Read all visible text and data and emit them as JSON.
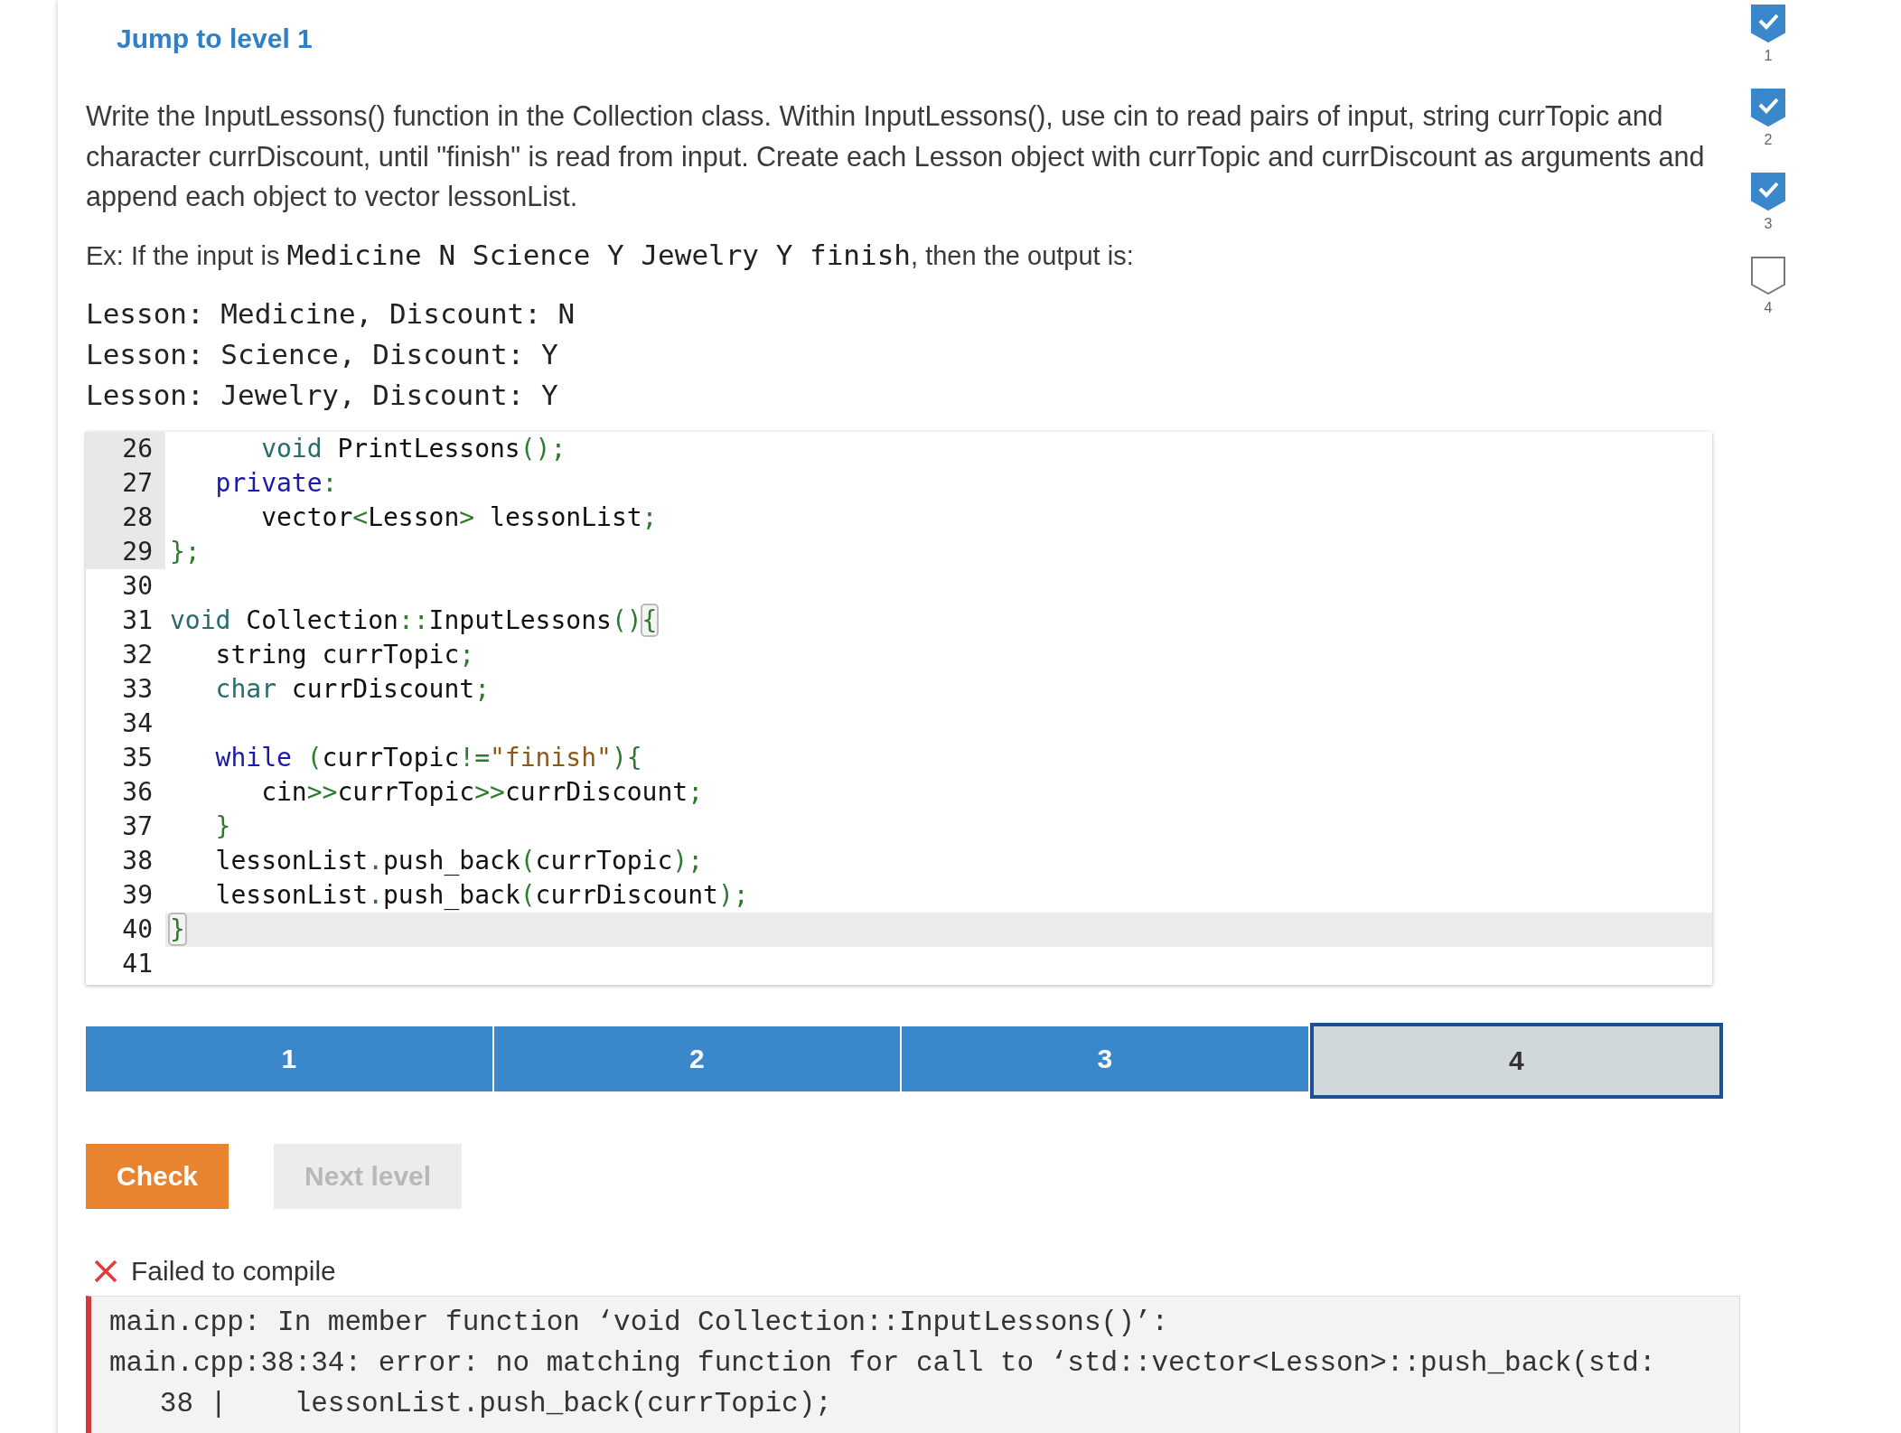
{
  "jump_link": "Jump to level 1",
  "instructions": "Write the InputLessons() function in the Collection class. Within InputLessons(), use cin to read pairs of input, string currTopic and character currDiscount, until \"finish\" is read from input. Create each Lesson object with currTopic and currDiscount as arguments and append each object to vector lessonList.",
  "example": {
    "prefix": "Ex: If the input is ",
    "input": "Medicine N Science Y Jewelry Y finish",
    "suffix": ", then the output is:"
  },
  "expected_output": [
    "Lesson: Medicine, Discount: N",
    "Lesson: Science, Discount: Y",
    "Lesson: Jewelry, Discount: Y"
  ],
  "code_editor": {
    "lines": [
      {
        "number": "26",
        "marked": true,
        "active": false,
        "tokens": [
          {
            "t": "      void",
            "kind": "type"
          },
          {
            "t": " PrintLessons",
            "kind": "plain"
          },
          {
            "t": "();",
            "kind": "punct"
          }
        ]
      },
      {
        "number": "27",
        "marked": true,
        "active": false,
        "tokens": [
          {
            "t": "   private",
            "kind": "keyword"
          },
          {
            "t": ":",
            "kind": "punct"
          }
        ]
      },
      {
        "number": "28",
        "marked": true,
        "active": false,
        "tokens": [
          {
            "t": "      vector",
            "kind": "plain"
          },
          {
            "t": "<",
            "kind": "punct"
          },
          {
            "t": "Lesson",
            "kind": "plain"
          },
          {
            "t": ">",
            "kind": "punct"
          },
          {
            "t": " lessonList",
            "kind": "plain"
          },
          {
            "t": ";",
            "kind": "punct"
          }
        ]
      },
      {
        "number": "29",
        "marked": true,
        "active": false,
        "tokens": [
          {
            "t": "};",
            "kind": "punct"
          }
        ]
      },
      {
        "number": "30",
        "marked": false,
        "active": false
      },
      {
        "number": "31",
        "marked": false,
        "active": false,
        "tokens": [
          {
            "t": "void",
            "kind": "type"
          },
          {
            "t": " Collection",
            "kind": "plain"
          },
          {
            "t": "::",
            "kind": "punct"
          },
          {
            "t": "InputLessons",
            "kind": "plain"
          },
          {
            "t": "()",
            "kind": "punct"
          },
          {
            "t": "{",
            "kind": "bracket_match"
          }
        ]
      },
      {
        "number": "32",
        "marked": false,
        "active": false,
        "tokens": [
          {
            "t": "   string currTopic",
            "kind": "plain"
          },
          {
            "t": ";",
            "kind": "punct"
          }
        ]
      },
      {
        "number": "33",
        "marked": false,
        "active": false,
        "tokens": [
          {
            "t": "   char",
            "kind": "type"
          },
          {
            "t": " currDiscount",
            "kind": "plain"
          },
          {
            "t": ";",
            "kind": "punct"
          }
        ]
      },
      {
        "number": "34",
        "marked": false,
        "active": false
      },
      {
        "number": "35",
        "marked": false,
        "active": false,
        "tokens": [
          {
            "t": "   while",
            "kind": "keyword"
          },
          {
            "t": " (",
            "kind": "punct"
          },
          {
            "t": "currTopic",
            "kind": "plain"
          },
          {
            "t": "!=",
            "kind": "punct"
          },
          {
            "t": "\"finish\"",
            "kind": "string"
          },
          {
            "t": "){",
            "kind": "punct"
          }
        ]
      },
      {
        "number": "36",
        "marked": false,
        "active": false,
        "tokens": [
          {
            "t": "      cin",
            "kind": "plain"
          },
          {
            "t": ">>",
            "kind": "punct"
          },
          {
            "t": "currTopic",
            "kind": "plain"
          },
          {
            "t": ">>",
            "kind": "punct"
          },
          {
            "t": "currDiscount",
            "kind": "plain"
          },
          {
            "t": ";",
            "kind": "punct"
          }
        ]
      },
      {
        "number": "37",
        "marked": false,
        "active": false,
        "tokens": [
          {
            "t": "   }",
            "kind": "punct"
          }
        ]
      },
      {
        "number": "38",
        "marked": false,
        "active": false,
        "tokens": [
          {
            "t": "   lessonList",
            "kind": "plain"
          },
          {
            "t": ".",
            "kind": "punct"
          },
          {
            "t": "push_back",
            "kind": "plain"
          },
          {
            "t": "(",
            "kind": "punct"
          },
          {
            "t": "currTopic",
            "kind": "plain"
          },
          {
            "t": ");",
            "kind": "punct"
          }
        ]
      },
      {
        "number": "39",
        "marked": false,
        "active": false,
        "tokens": [
          {
            "t": "   lessonList",
            "kind": "plain"
          },
          {
            "t": ".",
            "kind": "punct"
          },
          {
            "t": "push_back",
            "kind": "plain"
          },
          {
            "t": "(",
            "kind": "punct"
          },
          {
            "t": "currDiscount",
            "kind": "plain"
          },
          {
            "t": ");",
            "kind": "punct"
          }
        ]
      },
      {
        "number": "40",
        "marked": false,
        "active": true,
        "tokens": [
          {
            "t": "}",
            "kind": "bracket_match"
          }
        ]
      },
      {
        "number": "41",
        "marked": false,
        "active": false
      }
    ]
  },
  "levels": [
    {
      "label": "1",
      "completed": true,
      "selected": false
    },
    {
      "label": "2",
      "completed": true,
      "selected": false
    },
    {
      "label": "3",
      "completed": true,
      "selected": false
    },
    {
      "label": "4",
      "completed": false,
      "selected": true
    }
  ],
  "buttons": [
    {
      "label": "Check",
      "kind": "primary",
      "disabled": false
    },
    {
      "label": "Next level",
      "kind": "secondary",
      "disabled": true
    }
  ],
  "result": {
    "status": "Failed to compile",
    "errors": [
      "main.cpp: In member function ‘void Collection::InputLessons()’:",
      "main.cpp:38:34: error: no matching function for call to ‘std::vector<Lesson>::push_back(std:",
      "   38 |    lessonList.push_back(currTopic);"
    ]
  },
  "sidebar_levels": [
    {
      "label": "1",
      "done": true
    },
    {
      "label": "2",
      "done": true
    },
    {
      "label": "3",
      "done": true
    },
    {
      "label": "4",
      "done": false
    }
  ]
}
